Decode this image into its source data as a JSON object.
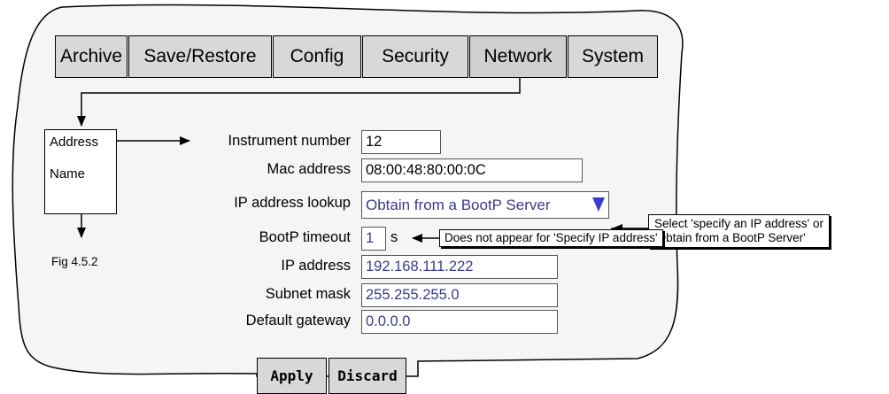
{
  "tabs": [
    "Archive",
    "Save/Restore",
    "Config",
    "Security",
    "Network",
    "System"
  ],
  "menu": {
    "items": [
      "Address",
      "Name"
    ]
  },
  "figure_caption": "Fig 4.5.2",
  "fields": {
    "instrument_number": {
      "label": "Instrument number",
      "value": "12"
    },
    "mac_address": {
      "label": "Mac address",
      "value": "08:00:48:80:00:0C"
    },
    "ip_lookup": {
      "label": "IP address lookup",
      "value": "Obtain from a BootP Server"
    },
    "bootp_timeout": {
      "label": "BootP timeout",
      "value": "1",
      "unit": "s"
    },
    "ip_address": {
      "label": "IP address",
      "value": "192.168.111.222"
    },
    "subnet_mask": {
      "label": "Subnet mask",
      "value": "255.255.255.0"
    },
    "default_gateway": {
      "label": "Default gateway",
      "value": "0.0.0.0"
    }
  },
  "notes": {
    "ip_lookup_line1": "Select 'specify an IP address' or",
    "ip_lookup_line2": "'Obtain from a BootP Server'",
    "bootp": "Does not appear for 'Specify IP address'"
  },
  "buttons": {
    "apply": "Apply",
    "discard": "Discard"
  },
  "colors": {
    "panel": "#f5f5f5",
    "tab": "#d8d8d8",
    "value_text": "#3a3a8a",
    "dropdown_arrow": "#3a3ad0"
  }
}
